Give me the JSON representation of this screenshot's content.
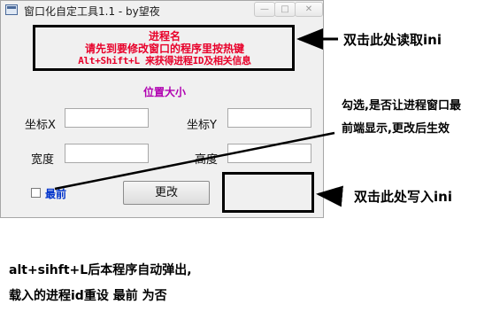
{
  "window": {
    "title": "窗口化自定工具1.1 - by望夜",
    "controls": {
      "minimize": "—",
      "maximize": "□",
      "close": "✕"
    }
  },
  "process": {
    "name": "进程名",
    "hint_line1": "请先到要修改窗口的程序里按热键",
    "hint_line2": "Alt+Shift+L  来获得进程ID及相关信息"
  },
  "position_size_label": "位置大小",
  "fields": {
    "x_label": "坐标X",
    "y_label": "坐标Y",
    "width_label": "宽度",
    "height_label": "高度",
    "x_value": "",
    "y_value": "",
    "width_value": "",
    "height_value": ""
  },
  "topmost": {
    "label": "最前",
    "checked": false
  },
  "change_button": "更改",
  "annotations": {
    "read_ini": "双击此处读取ini",
    "topmost_note_line1": "勾选,是否让进程窗口最",
    "topmost_note_line2": "前端显示,更改后生效",
    "write_ini": "双击此处写入ini",
    "bottom_note_line1": "alt+sihft+L后本程序自动弹出,",
    "bottom_note_line2": "载入的进程id重设 最前 为否"
  },
  "colors": {
    "process_text": "#e8002a",
    "position_label": "#b000b0",
    "topmost_label": "#0033cc",
    "window_bg": "#f0f0f0"
  },
  "icons": [
    "app-window-icon",
    "minimize-icon",
    "maximize-icon",
    "close-icon",
    "checkbox-icon",
    "arrow-icon"
  ]
}
